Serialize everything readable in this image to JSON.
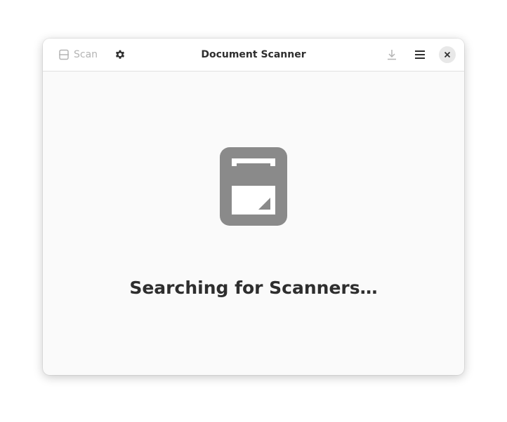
{
  "window": {
    "title": "Document Scanner"
  },
  "toolbar": {
    "scan_label": "Scan",
    "scan_icon": "scanner-icon",
    "settings_icon": "gear-icon",
    "save_icon": "download-icon",
    "menu_icon": "hamburger-menu-icon",
    "close_icon": "close-icon"
  },
  "main": {
    "status_icon": "document-scanner-icon",
    "status_text": "Searching for Scanners…"
  },
  "colors": {
    "accent_icon": "#8a8a8a",
    "disabled_text": "#b4b4b4",
    "text": "#2e2e2e",
    "background": "#fafafa"
  }
}
